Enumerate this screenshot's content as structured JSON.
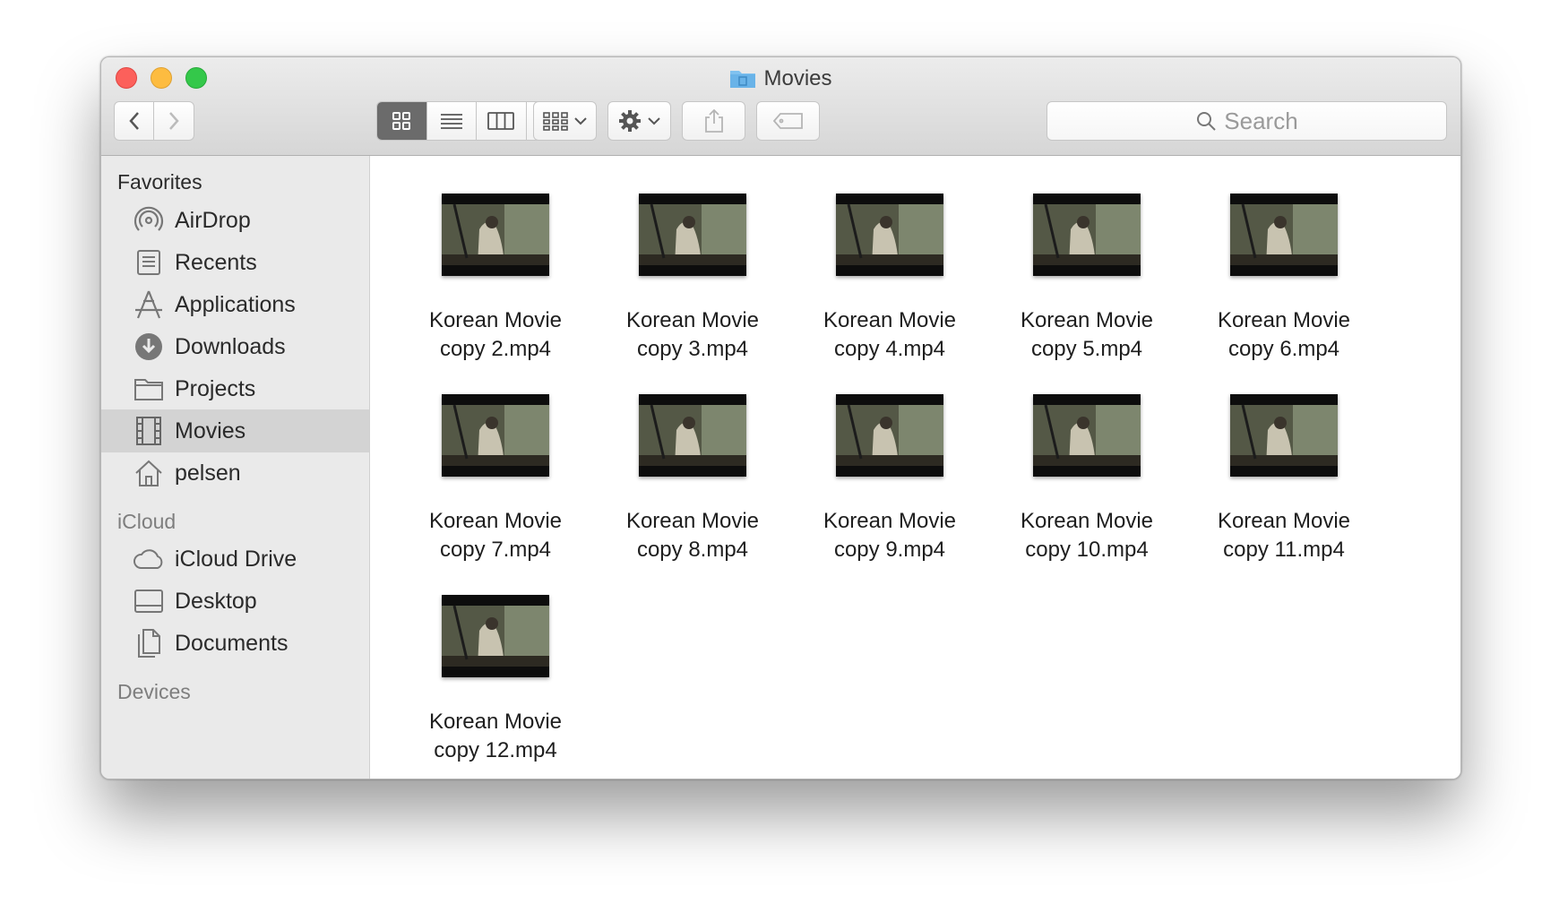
{
  "window": {
    "title": "Movies"
  },
  "toolbar": {
    "search_placeholder": "Search"
  },
  "sidebar": {
    "sections": [
      {
        "heading": "Favorites",
        "items": [
          {
            "label": "AirDrop",
            "icon": "airdrop-icon"
          },
          {
            "label": "Recents",
            "icon": "recents-icon"
          },
          {
            "label": "Applications",
            "icon": "applications-icon"
          },
          {
            "label": "Downloads",
            "icon": "downloads-icon"
          },
          {
            "label": "Projects",
            "icon": "folder-icon"
          },
          {
            "label": "Movies",
            "icon": "film-icon",
            "selected": true
          },
          {
            "label": "pelsen",
            "icon": "home-icon"
          }
        ]
      },
      {
        "heading": "iCloud",
        "items": [
          {
            "label": "iCloud Drive",
            "icon": "cloud-icon"
          },
          {
            "label": "Desktop",
            "icon": "desktop-icon"
          },
          {
            "label": "Documents",
            "icon": "documents-icon"
          }
        ]
      },
      {
        "heading": "Devices",
        "items": []
      }
    ]
  },
  "files": [
    {
      "line1": "Korean Movie",
      "line2": "copy 2.mp4"
    },
    {
      "line1": "Korean Movie",
      "line2": "copy 3.mp4"
    },
    {
      "line1": "Korean Movie",
      "line2": "copy 4.mp4"
    },
    {
      "line1": "Korean Movie",
      "line2": "copy 5.mp4"
    },
    {
      "line1": "Korean Movie",
      "line2": "copy 6.mp4"
    },
    {
      "line1": "Korean Movie",
      "line2": "copy 7.mp4"
    },
    {
      "line1": "Korean Movie",
      "line2": "copy 8.mp4"
    },
    {
      "line1": "Korean Movie",
      "line2": "copy 9.mp4"
    },
    {
      "line1": "Korean Movie",
      "line2": "copy 10.mp4"
    },
    {
      "line1": "Korean Movie",
      "line2": "copy 11.mp4"
    },
    {
      "line1": "Korean Movie",
      "line2": "copy 12.mp4"
    }
  ],
  "colors": {
    "selection": "#d3d3d3",
    "active_view": "#6b6b6b",
    "sidebar_bg": "#eaeaea"
  }
}
